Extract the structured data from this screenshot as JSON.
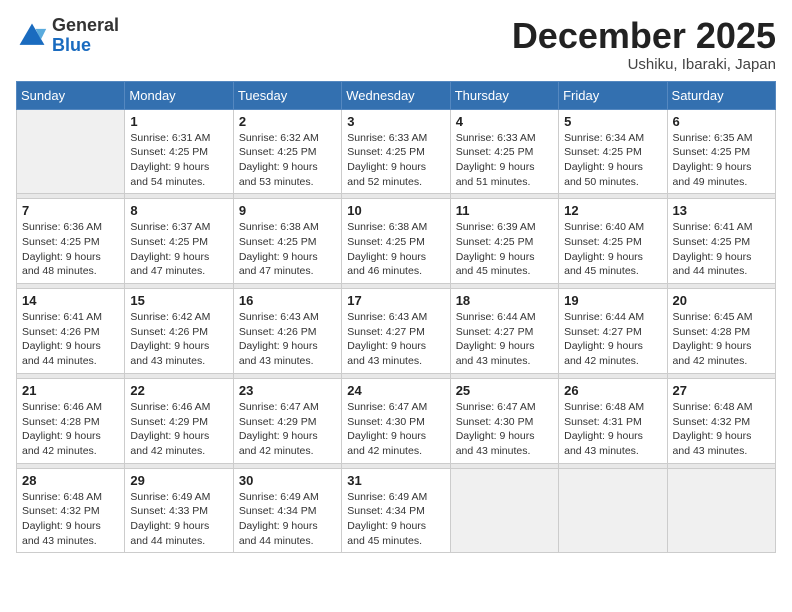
{
  "logo": {
    "general": "General",
    "blue": "Blue"
  },
  "title": {
    "month": "December 2025",
    "location": "Ushiku, Ibaraki, Japan"
  },
  "weekdays": [
    "Sunday",
    "Monday",
    "Tuesday",
    "Wednesday",
    "Thursday",
    "Friday",
    "Saturday"
  ],
  "weeks": [
    [
      {
        "day": "",
        "info": ""
      },
      {
        "day": "1",
        "info": "Sunrise: 6:31 AM\nSunset: 4:25 PM\nDaylight: 9 hours\nand 54 minutes."
      },
      {
        "day": "2",
        "info": "Sunrise: 6:32 AM\nSunset: 4:25 PM\nDaylight: 9 hours\nand 53 minutes."
      },
      {
        "day": "3",
        "info": "Sunrise: 6:33 AM\nSunset: 4:25 PM\nDaylight: 9 hours\nand 52 minutes."
      },
      {
        "day": "4",
        "info": "Sunrise: 6:33 AM\nSunset: 4:25 PM\nDaylight: 9 hours\nand 51 minutes."
      },
      {
        "day": "5",
        "info": "Sunrise: 6:34 AM\nSunset: 4:25 PM\nDaylight: 9 hours\nand 50 minutes."
      },
      {
        "day": "6",
        "info": "Sunrise: 6:35 AM\nSunset: 4:25 PM\nDaylight: 9 hours\nand 49 minutes."
      }
    ],
    [
      {
        "day": "7",
        "info": "Sunrise: 6:36 AM\nSunset: 4:25 PM\nDaylight: 9 hours\nand 48 minutes."
      },
      {
        "day": "8",
        "info": "Sunrise: 6:37 AM\nSunset: 4:25 PM\nDaylight: 9 hours\nand 47 minutes."
      },
      {
        "day": "9",
        "info": "Sunrise: 6:38 AM\nSunset: 4:25 PM\nDaylight: 9 hours\nand 47 minutes."
      },
      {
        "day": "10",
        "info": "Sunrise: 6:38 AM\nSunset: 4:25 PM\nDaylight: 9 hours\nand 46 minutes."
      },
      {
        "day": "11",
        "info": "Sunrise: 6:39 AM\nSunset: 4:25 PM\nDaylight: 9 hours\nand 45 minutes."
      },
      {
        "day": "12",
        "info": "Sunrise: 6:40 AM\nSunset: 4:25 PM\nDaylight: 9 hours\nand 45 minutes."
      },
      {
        "day": "13",
        "info": "Sunrise: 6:41 AM\nSunset: 4:25 PM\nDaylight: 9 hours\nand 44 minutes."
      }
    ],
    [
      {
        "day": "14",
        "info": "Sunrise: 6:41 AM\nSunset: 4:26 PM\nDaylight: 9 hours\nand 44 minutes."
      },
      {
        "day": "15",
        "info": "Sunrise: 6:42 AM\nSunset: 4:26 PM\nDaylight: 9 hours\nand 43 minutes."
      },
      {
        "day": "16",
        "info": "Sunrise: 6:43 AM\nSunset: 4:26 PM\nDaylight: 9 hours\nand 43 minutes."
      },
      {
        "day": "17",
        "info": "Sunrise: 6:43 AM\nSunset: 4:27 PM\nDaylight: 9 hours\nand 43 minutes."
      },
      {
        "day": "18",
        "info": "Sunrise: 6:44 AM\nSunset: 4:27 PM\nDaylight: 9 hours\nand 43 minutes."
      },
      {
        "day": "19",
        "info": "Sunrise: 6:44 AM\nSunset: 4:27 PM\nDaylight: 9 hours\nand 42 minutes."
      },
      {
        "day": "20",
        "info": "Sunrise: 6:45 AM\nSunset: 4:28 PM\nDaylight: 9 hours\nand 42 minutes."
      }
    ],
    [
      {
        "day": "21",
        "info": "Sunrise: 6:46 AM\nSunset: 4:28 PM\nDaylight: 9 hours\nand 42 minutes."
      },
      {
        "day": "22",
        "info": "Sunrise: 6:46 AM\nSunset: 4:29 PM\nDaylight: 9 hours\nand 42 minutes."
      },
      {
        "day": "23",
        "info": "Sunrise: 6:47 AM\nSunset: 4:29 PM\nDaylight: 9 hours\nand 42 minutes."
      },
      {
        "day": "24",
        "info": "Sunrise: 6:47 AM\nSunset: 4:30 PM\nDaylight: 9 hours\nand 42 minutes."
      },
      {
        "day": "25",
        "info": "Sunrise: 6:47 AM\nSunset: 4:30 PM\nDaylight: 9 hours\nand 43 minutes."
      },
      {
        "day": "26",
        "info": "Sunrise: 6:48 AM\nSunset: 4:31 PM\nDaylight: 9 hours\nand 43 minutes."
      },
      {
        "day": "27",
        "info": "Sunrise: 6:48 AM\nSunset: 4:32 PM\nDaylight: 9 hours\nand 43 minutes."
      }
    ],
    [
      {
        "day": "28",
        "info": "Sunrise: 6:48 AM\nSunset: 4:32 PM\nDaylight: 9 hours\nand 43 minutes."
      },
      {
        "day": "29",
        "info": "Sunrise: 6:49 AM\nSunset: 4:33 PM\nDaylight: 9 hours\nand 44 minutes."
      },
      {
        "day": "30",
        "info": "Sunrise: 6:49 AM\nSunset: 4:34 PM\nDaylight: 9 hours\nand 44 minutes."
      },
      {
        "day": "31",
        "info": "Sunrise: 6:49 AM\nSunset: 4:34 PM\nDaylight: 9 hours\nand 45 minutes."
      },
      {
        "day": "",
        "info": ""
      },
      {
        "day": "",
        "info": ""
      },
      {
        "day": "",
        "info": ""
      }
    ]
  ]
}
